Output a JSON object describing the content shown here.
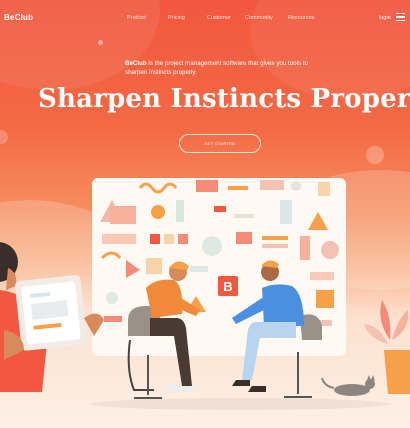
{
  "brand": {
    "logo": "BeClub"
  },
  "nav": {
    "items": [
      "Product",
      "Pricing",
      "Customer",
      "Community",
      "Resources"
    ],
    "login": "login"
  },
  "hero": {
    "tagline_brand": "BeClub",
    "tagline_text": " is the project management software that gives you tools to sharpen instincts properly.",
    "headline": "Sharpen Instincts Properly",
    "cta_label": "GET STARTED"
  },
  "illustration": {
    "board_letter": "B"
  },
  "colors": {
    "accent": "#f2573f",
    "accent_light": "#f9b48c",
    "blue_shirt": "#4a8fe0",
    "orange_shirt": "#f08a3a"
  }
}
